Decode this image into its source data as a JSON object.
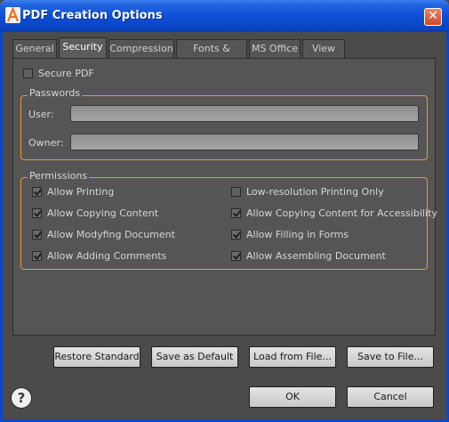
{
  "window": {
    "title": "PDF Creation Options",
    "close_symbol": "✕",
    "app_icon": "acrobat-icon"
  },
  "tabs": [
    {
      "label": "General"
    },
    {
      "label": "Security",
      "active": true
    },
    {
      "label": "Compression"
    },
    {
      "label": "Fonts & Colors"
    },
    {
      "label": "MS Office"
    },
    {
      "label": "View"
    }
  ],
  "security": {
    "secure_pdf": {
      "label": "Secure PDF",
      "checked": false
    },
    "passwords": {
      "title": "Passwords",
      "user_label": "User:",
      "user_value": "",
      "owner_label": "Owner:",
      "owner_value": ""
    },
    "permissions": {
      "title": "Permissions",
      "left": [
        {
          "label": "Allow Printing",
          "checked": true
        },
        {
          "label": "Allow Copying Content",
          "checked": true
        },
        {
          "label": "Allow Modyfing Document",
          "checked": true
        },
        {
          "label": "Allow Adding Comments",
          "checked": true
        }
      ],
      "right": [
        {
          "label": "Low-resolution Printing Only",
          "checked": false
        },
        {
          "label": "Allow Copying Content for Accessibility",
          "checked": true
        },
        {
          "label": "Allow Filling in Forms",
          "checked": true
        },
        {
          "label": "Allow Assembling Document",
          "checked": true
        }
      ]
    }
  },
  "actions": {
    "restore_standard": "Restore Standard",
    "save_as_default": "Save as Default",
    "load_from_file": "Load from File...",
    "save_to_file": "Save to File..."
  },
  "footer": {
    "help_symbol": "?",
    "ok": "OK",
    "cancel": "Cancel"
  },
  "colors": {
    "accent_orange": "#e89a2c",
    "title_blue": "#0a45c4",
    "panel_bg": "#555555"
  }
}
